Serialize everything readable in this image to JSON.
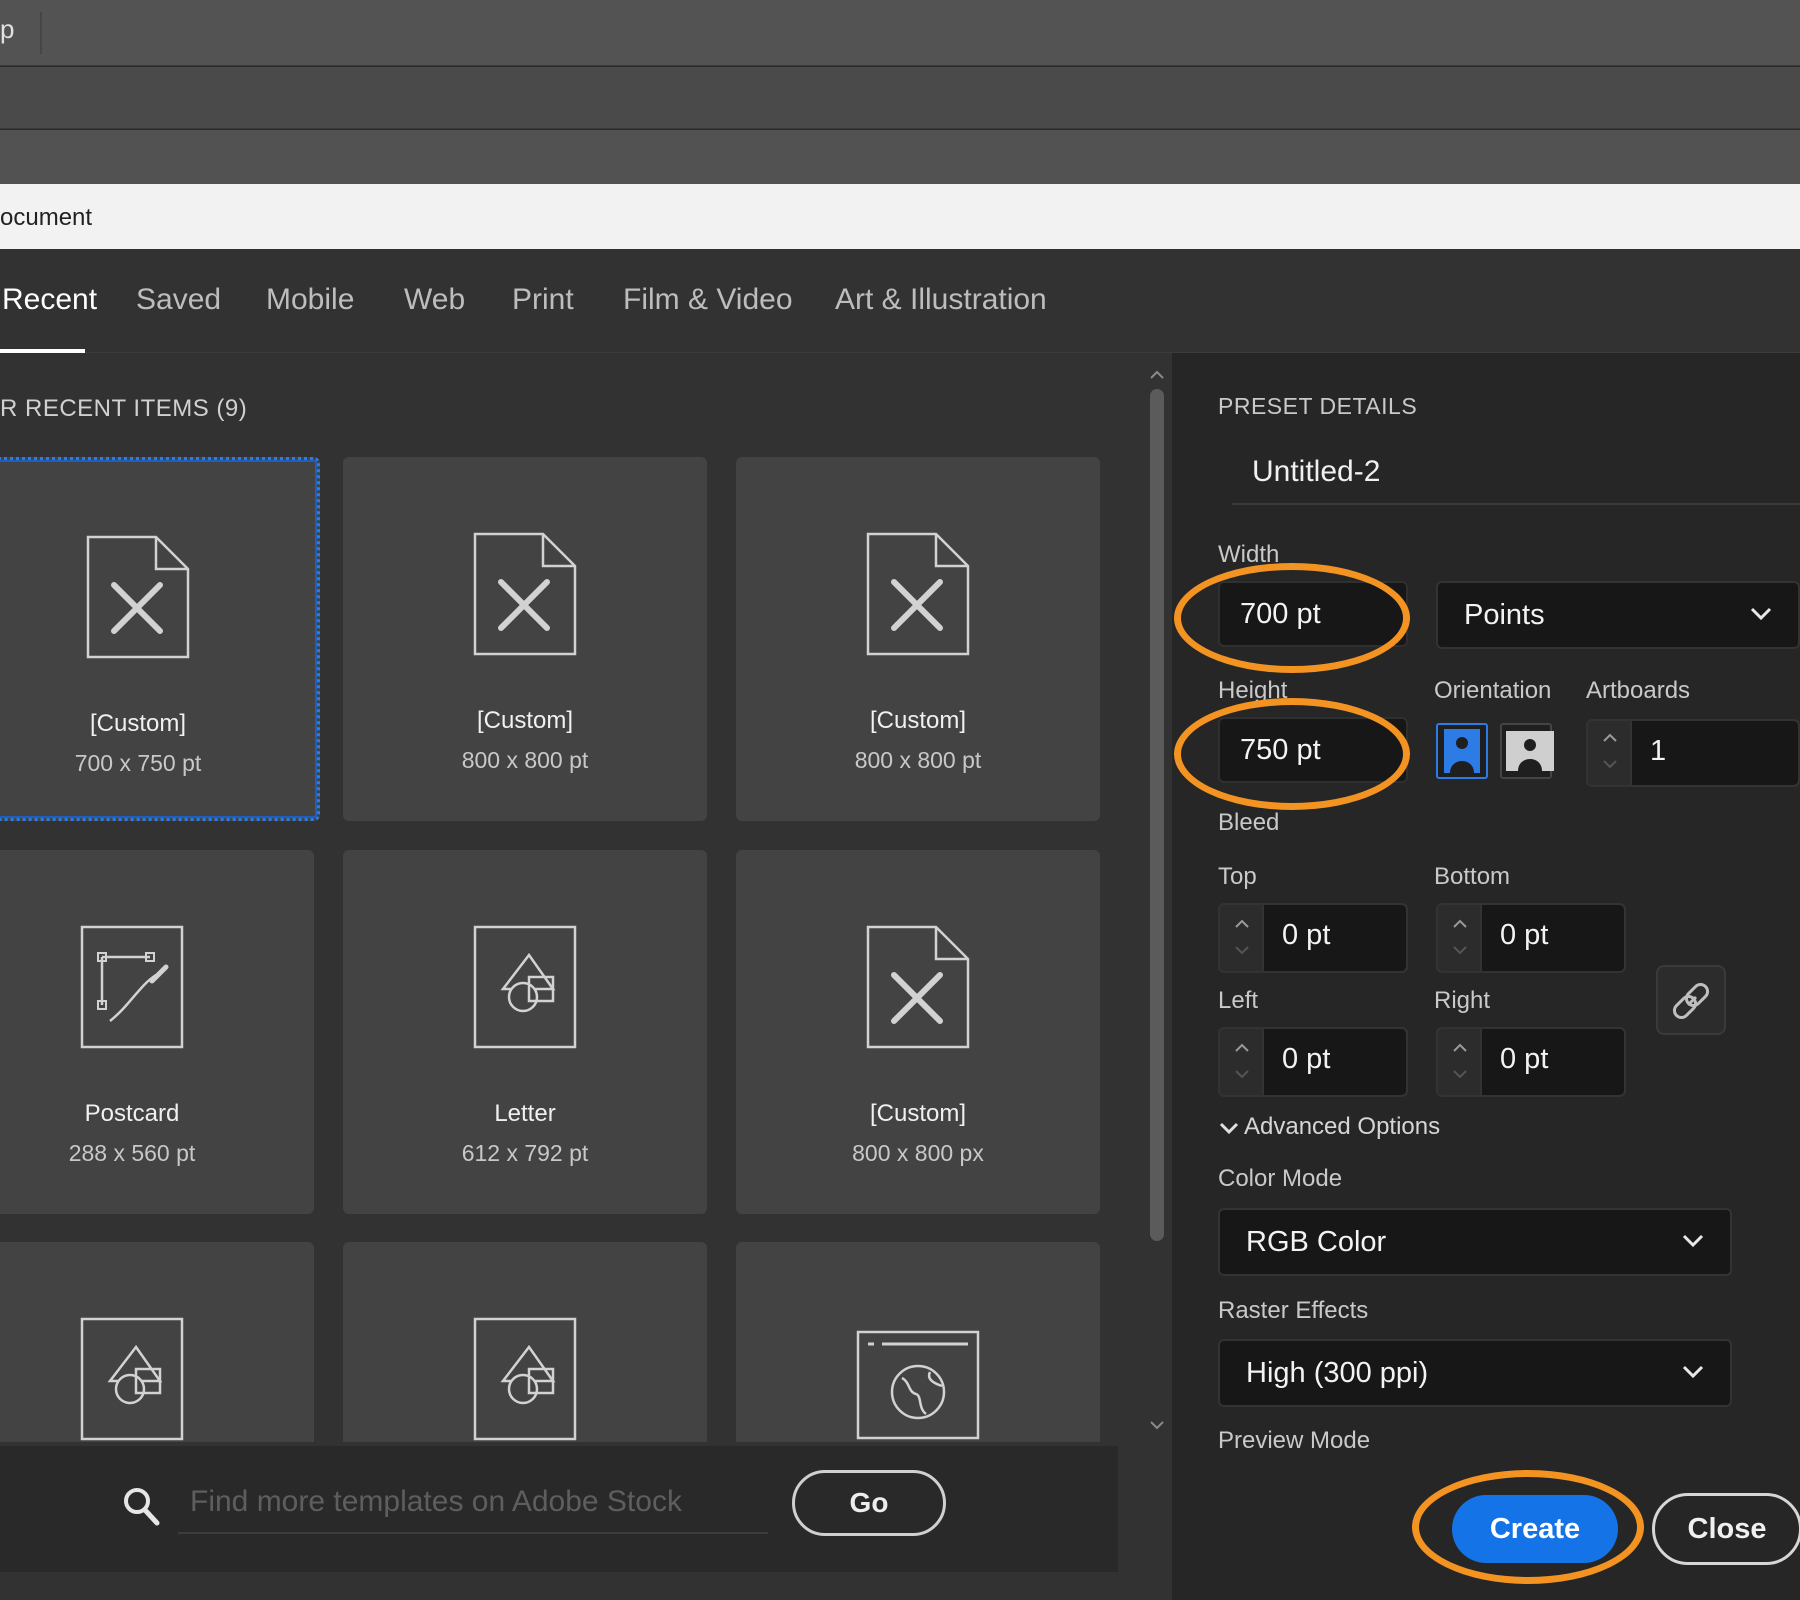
{
  "window": {
    "menu_fragment": "p",
    "dialog_title": "ocument"
  },
  "tabs": [
    "Recent",
    "Saved",
    "Mobile",
    "Web",
    "Print",
    "Film & Video",
    "Art & Illustration"
  ],
  "recent": {
    "section_title": "R RECENT ITEMS  (9)",
    "items": [
      {
        "name": "[Custom]",
        "size": "700 x 750 pt",
        "icon": "custom-doc-icon",
        "selected": true
      },
      {
        "name": "[Custom]",
        "size": "800 x 800 pt",
        "icon": "custom-doc-icon"
      },
      {
        "name": "[Custom]",
        "size": "800 x 800 pt",
        "icon": "custom-doc-icon"
      },
      {
        "name": "Postcard",
        "size": "288 x 560 pt",
        "icon": "postcard-icon"
      },
      {
        "name": "Letter",
        "size": "612 x 792 pt",
        "icon": "shapes-doc-icon"
      },
      {
        "name": "[Custom]",
        "size": "800 x 800 px",
        "icon": "custom-doc-icon"
      },
      {
        "icon": "shapes-doc-icon"
      },
      {
        "icon": "shapes-doc-icon"
      },
      {
        "icon": "web-doc-icon"
      }
    ]
  },
  "search": {
    "placeholder": "Find more templates on Adobe Stock",
    "go_label": "Go"
  },
  "preset": {
    "section_title": "PRESET DETAILS",
    "doc_name": "Untitled-2",
    "width_label": "Width",
    "width_value": "700 pt",
    "units": "Points",
    "height_label": "Height",
    "height_value": "750 pt",
    "orientation_label": "Orientation",
    "artboards_label": "Artboards",
    "artboards_value": "1",
    "bleed_label": "Bleed",
    "bleed": {
      "top_label": "Top",
      "top_value": "0 pt",
      "bottom_label": "Bottom",
      "bottom_value": "0 pt",
      "left_label": "Left",
      "left_value": "0 pt",
      "right_label": "Right",
      "right_value": "0 pt"
    },
    "advanced_label": "Advanced Options",
    "color_mode_label": "Color Mode",
    "color_mode_value": "RGB Color",
    "raster_label": "Raster Effects",
    "raster_value": "High (300 ppi)",
    "preview_label": "Preview Mode"
  },
  "buttons": {
    "create": "Create",
    "close": "Close"
  },
  "colors": {
    "accent_blue": "#1473e6",
    "highlight_orange": "#f39322",
    "selection_blue": "#2d7be5"
  }
}
